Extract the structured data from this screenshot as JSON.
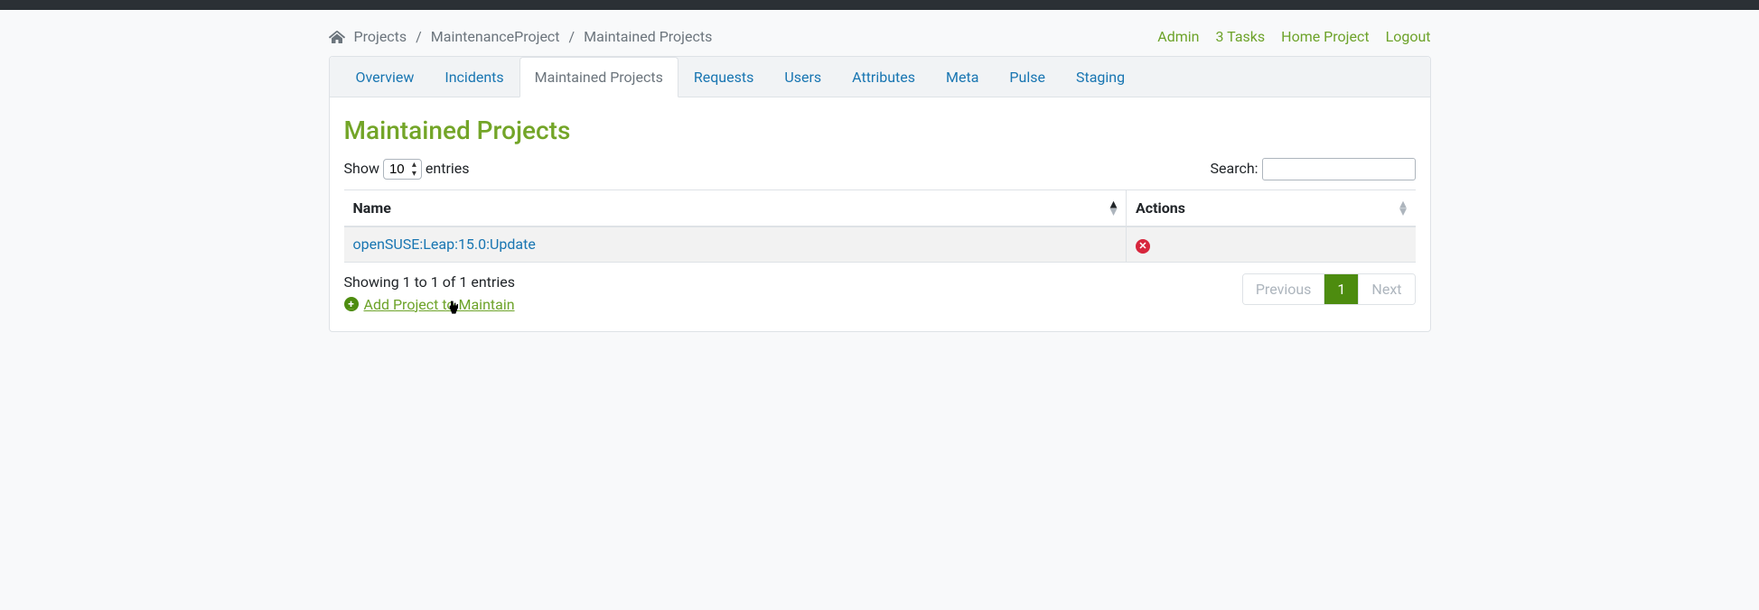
{
  "breadcrumb": {
    "projects": "Projects",
    "project_name": "MaintenanceProject",
    "current": "Maintained Projects"
  },
  "toplinks": {
    "admin": "Admin",
    "tasks": "3 Tasks",
    "home_project": "Home Project",
    "logout": "Logout"
  },
  "tabs": {
    "overview": "Overview",
    "incidents": "Incidents",
    "maintained": "Maintained Projects",
    "requests": "Requests",
    "users": "Users",
    "attributes": "Attributes",
    "meta": "Meta",
    "pulse": "Pulse",
    "staging": "Staging"
  },
  "page": {
    "title": "Maintained Projects"
  },
  "table_controls": {
    "show_prefix": "Show",
    "show_value": "10",
    "show_suffix": "entries",
    "search_label": "Search:",
    "search_value": ""
  },
  "columns": {
    "name": "Name",
    "actions": "Actions"
  },
  "rows": [
    {
      "name": "openSUSE:Leap:15.0:Update"
    }
  ],
  "footer": {
    "info": "Showing 1 to 1 of 1 entries",
    "add_link": "Add Project to Maintain"
  },
  "pager": {
    "previous": "Previous",
    "page": "1",
    "next": "Next"
  }
}
